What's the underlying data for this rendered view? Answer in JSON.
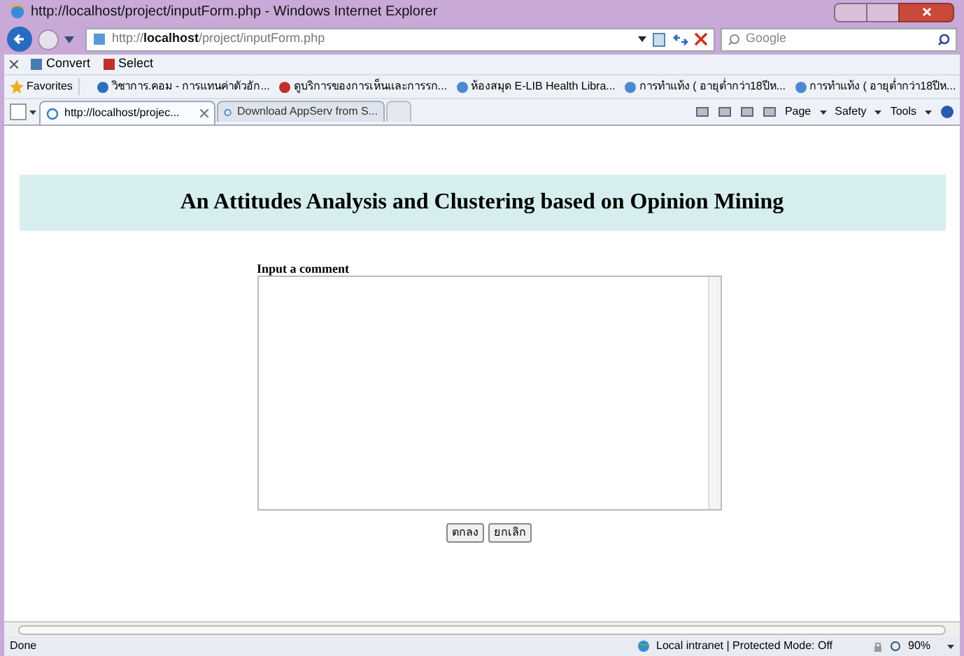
{
  "window": {
    "title": "http://localhost/project/inputForm.php - Windows Internet Explorer"
  },
  "address_bar": {
    "url_prefix": "http://",
    "url_host": "localhost",
    "url_path": "/project/inputForm.php"
  },
  "search": {
    "placeholder": "Google"
  },
  "toolbar": {
    "items": [
      "Convert",
      "Select"
    ]
  },
  "favorites_bar": {
    "label": "Favorites",
    "items": [
      "วิชาการ.คอม - การแทนค่าตัวอัก...",
      "ดูบริการของการเห็นและการรก...",
      "ห้องสมุด E-LIB  Health Libra...",
      "การทำแท้ง ( อายุต่ำกว่า18ปีห...",
      "การทำแท้ง ( อายุต่ำกว่า18ปีห..."
    ]
  },
  "tabs": [
    {
      "label": "http://localhost/projec...",
      "selected": true
    },
    {
      "label": "Download AppServ from S...",
      "selected": false
    }
  ],
  "command_bar": [
    "Page",
    "Safety",
    "Tools"
  ],
  "page": {
    "heading": "An Attitudes Analysis and Clustering based on Opinion Mining",
    "form_label": "Input a comment",
    "buttons": [
      "ตกลง",
      "ยกเลิก"
    ]
  },
  "status_bar": {
    "text": "Done",
    "zone": "Local intranet | Protected Mode: Off",
    "zoom": "90%"
  }
}
